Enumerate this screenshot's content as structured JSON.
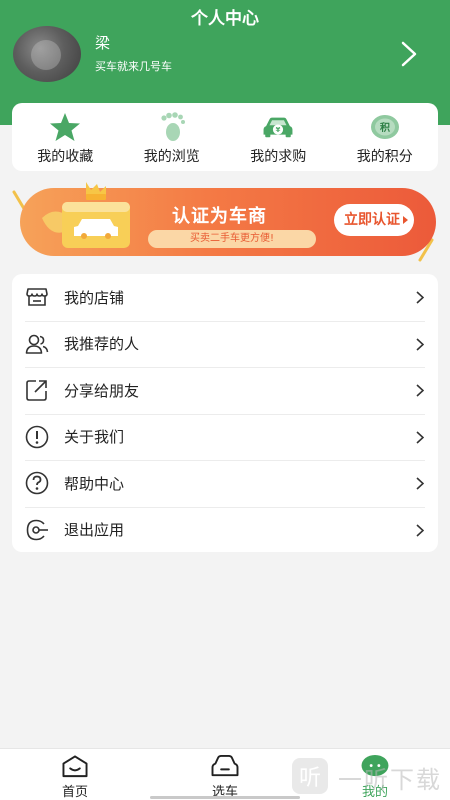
{
  "header": {
    "title": "个人中心",
    "user_name": "梁",
    "slogan": "买车就来几号车"
  },
  "quick_actions": [
    {
      "label": "我的收藏",
      "icon": "star-icon"
    },
    {
      "label": "我的浏览",
      "icon": "footprint-icon"
    },
    {
      "label": "我的求购",
      "icon": "car-yen-icon"
    },
    {
      "label": "我的积分",
      "icon": "points-icon"
    }
  ],
  "banner": {
    "title": "认证为车商",
    "subtitle": "买卖二手车更方便!",
    "button": "立即认证"
  },
  "menu": [
    {
      "label": "我的店铺",
      "icon": "store-icon"
    },
    {
      "label": "我推荐的人",
      "icon": "people-icon"
    },
    {
      "label": "分享给朋友",
      "icon": "share-icon"
    },
    {
      "label": "关于我们",
      "icon": "info-icon"
    },
    {
      "label": "帮助中心",
      "icon": "help-icon"
    },
    {
      "label": "退出应用",
      "icon": "logout-icon"
    }
  ],
  "tabs": [
    {
      "label": "首页",
      "icon": "home-icon"
    },
    {
      "label": "选车",
      "icon": "car-front-icon"
    },
    {
      "label": "我的",
      "icon": "profile-icon",
      "active": true
    }
  ],
  "watermark": {
    "text": "一听下载",
    "glyph": "听"
  },
  "colors": {
    "primary": "#3fa45c",
    "banner_orange": "#f47a45",
    "banner_red": "#ec5a3a"
  }
}
